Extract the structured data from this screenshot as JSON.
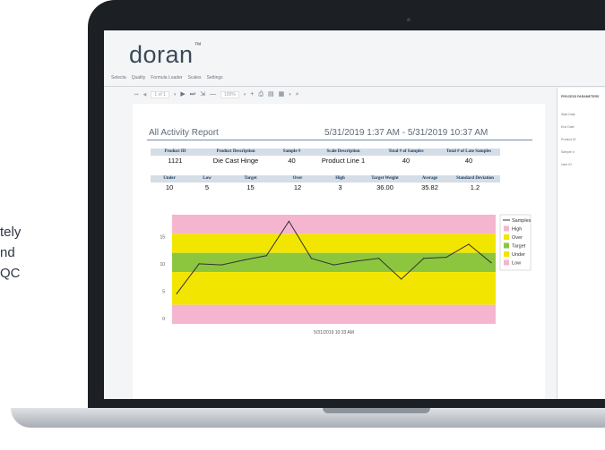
{
  "side_text": {
    "lines": [
      "tely",
      "nd",
      "QC"
    ]
  },
  "app": {
    "logo": "doran",
    "logo_mark": "™"
  },
  "menu": {
    "items": [
      "Selecta",
      "Quality",
      "Formula Loader",
      "Scales",
      "Settings"
    ]
  },
  "toolbar": {
    "page_field": "1 of 1",
    "zoom": "100%"
  },
  "report": {
    "title": "All Activity Report",
    "date_range": "5/31/2019 1:37 AM - 5/31/2019 10:37 AM",
    "table1": {
      "headers": [
        "Product ID",
        "Product Description",
        "Sample #",
        "Scale Description",
        "Total # of Samples",
        "Total # of Late Samples"
      ],
      "row": [
        "1121",
        "Die Cast Hinge",
        "40",
        "Product Line 1",
        "40",
        "40"
      ]
    },
    "table2": {
      "headers": [
        "Under",
        "Low",
        "Target",
        "Over",
        "High",
        "Target Weight",
        "Average",
        "Standard Deviation"
      ],
      "row": [
        "10",
        "5",
        "15",
        "12",
        "3",
        "36.00",
        "35.82",
        "1.2"
      ]
    }
  },
  "chart_data": {
    "type": "line",
    "x_axis_label": "5/31/2019 10:33 AM",
    "yticks": [
      0,
      5,
      10,
      15
    ],
    "ylim": [
      -1,
      19
    ],
    "bands": [
      {
        "name": "High",
        "from": 15.5,
        "to": 19,
        "color": "#f5b5cf"
      },
      {
        "name": "Over",
        "from": 12,
        "to": 15.5,
        "color": "#f2e600"
      },
      {
        "name": "Target",
        "from": 8.5,
        "to": 12,
        "color": "#8cc63f"
      },
      {
        "name": "Under",
        "from": 2.5,
        "to": 8.5,
        "color": "#f2e600"
      },
      {
        "name": "Low",
        "from": -1,
        "to": 2.5,
        "color": "#f5b5cf"
      }
    ],
    "legend": [
      {
        "name": "Samples",
        "color": "#333333",
        "kind": "line"
      },
      {
        "name": "High",
        "color": "#f5b5cf",
        "kind": "box"
      },
      {
        "name": "Over",
        "color": "#f2e600",
        "kind": "box"
      },
      {
        "name": "Target",
        "color": "#8cc63f",
        "kind": "box"
      },
      {
        "name": "Under",
        "color": "#f2e600",
        "kind": "box"
      },
      {
        "name": "Low",
        "color": "#f5b5cf",
        "kind": "box"
      }
    ],
    "legend_position": "right",
    "series": [
      {
        "name": "Samples",
        "values": [
          4.5,
          10,
          9.8,
          10.7,
          11.5,
          17.8,
          11,
          9.8,
          10.5,
          11,
          7.2,
          11,
          11.2,
          13.6,
          10.2
        ]
      }
    ]
  },
  "side_panel": {
    "title": "PROCESS PARAMETERS",
    "fields": [
      "Start Date",
      "End Date",
      "Product ID",
      "Sample #",
      "User ID"
    ]
  }
}
